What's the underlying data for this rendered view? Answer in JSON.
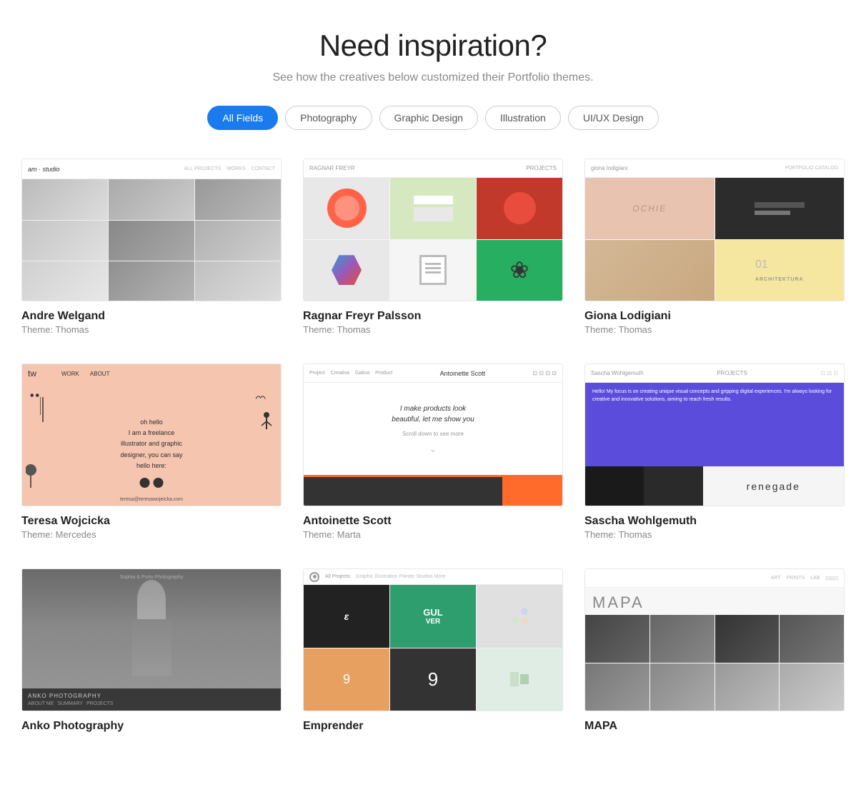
{
  "page": {
    "title": "Need inspiration?",
    "subtitle": "See how the creatives below customized their Portfolio themes."
  },
  "filters": {
    "items": [
      {
        "id": "all",
        "label": "All Fields",
        "active": true
      },
      {
        "id": "photography",
        "label": "Photography",
        "active": false
      },
      {
        "id": "graphic-design",
        "label": "Graphic Design",
        "active": false
      },
      {
        "id": "illustration",
        "label": "Illustration",
        "active": false
      },
      {
        "id": "uiux",
        "label": "UI/UX Design",
        "active": false
      }
    ]
  },
  "portfolio_items": [
    {
      "id": "andre-welgand",
      "name": "Andre Welgand",
      "theme_label": "Theme: Thomas"
    },
    {
      "id": "ragnar-freyr",
      "name": "Ragnar Freyr Palsson",
      "theme_label": "Theme: Thomas"
    },
    {
      "id": "giona-lodigiani",
      "name": "Giona Lodigiani",
      "theme_label": "Theme: Thomas"
    },
    {
      "id": "teresa-wojcicka",
      "name": "Teresa Wojcicka",
      "theme_label": "Theme: Mercedes"
    },
    {
      "id": "antoinette-scott",
      "name": "Antoinette Scott",
      "theme_label": "Theme: Marta"
    },
    {
      "id": "sascha-wohlgemuth",
      "name": "Sascha Wohlgemuth",
      "theme_label": "Theme: Thomas"
    },
    {
      "id": "anko-photography",
      "name": "Anko Photography",
      "theme_label": ""
    },
    {
      "id": "emprender",
      "name": "Emprender",
      "theme_label": ""
    },
    {
      "id": "mapa",
      "name": "MAPA",
      "theme_label": ""
    }
  ],
  "colors": {
    "accent_blue": "#1a7bef",
    "text_dark": "#222",
    "text_light": "#888",
    "border": "#ccc"
  },
  "labels": {
    "am_studio": "am · studio",
    "ragnar_name": "RAGNAR FREYR",
    "ragnar_projects": "PROJECTS",
    "giona_name": "giona lodigiani",
    "teresa_tw": "tw",
    "teresa_work": "WORK",
    "teresa_about": "ABOUT",
    "teresa_hello": "oh hello\nI am a freelance\nillustrator and graphic\ndesigner, you can say\nhello here:",
    "ant_name": "Antoinette Scott",
    "ant_tagline": "I make products look\nbeautiful, let me show you",
    "ant_scroll": "Scroll down to see more",
    "sascha_name": "Sascha Wohlgemuth",
    "sascha_projects": "PROJECTS",
    "sascha_bio": "Hello! My focus is on creating unique visual concepts and gripping digital experiences. I'm always looking for creative and innovative solutions, aiming to reach fresh results.",
    "sascha_renegade": "renegade",
    "mapa_title": "MAPA",
    "anko_footer": "ANKO PHOTOGRAPHY"
  }
}
